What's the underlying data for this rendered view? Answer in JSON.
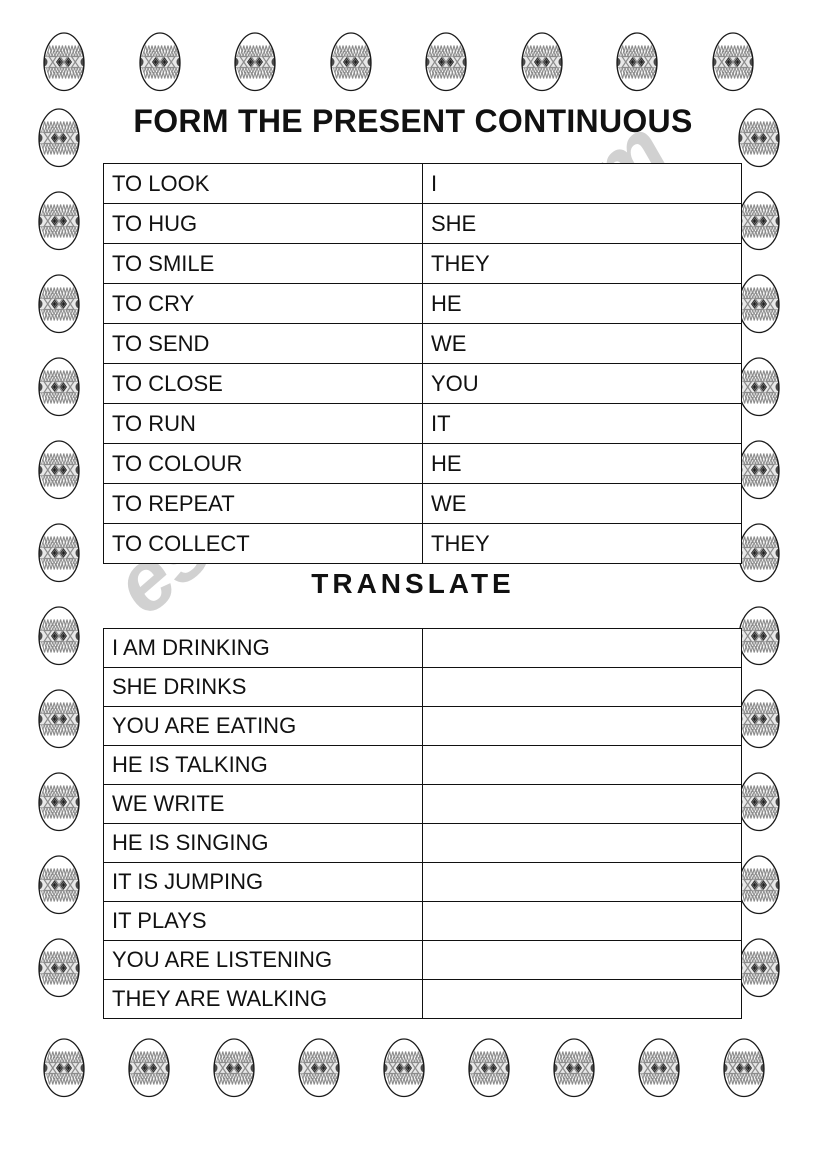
{
  "worksheet": {
    "section_one": {
      "title": "FORM THE PRESENT CONTINUOUS",
      "rows": [
        {
          "verb": "TO LOOK",
          "pronoun": "I"
        },
        {
          "verb": "TO HUG",
          "pronoun": "SHE"
        },
        {
          "verb": "TO SMILE",
          "pronoun": "THEY"
        },
        {
          "verb": "TO CRY",
          "pronoun": "HE"
        },
        {
          "verb": "TO SEND",
          "pronoun": "WE"
        },
        {
          "verb": "TO CLOSE",
          "pronoun": "YOU"
        },
        {
          "verb": "TO RUN",
          "pronoun": "IT"
        },
        {
          "verb": "TO COLOUR",
          "pronoun": "HE"
        },
        {
          "verb": "TO REPEAT",
          "pronoun": "WE"
        },
        {
          "verb": "TO COLLECT",
          "pronoun": "THEY"
        }
      ]
    },
    "section_two": {
      "title": "TRANSLATE",
      "rows": [
        {
          "sentence": "I AM DRINKING",
          "answer": ""
        },
        {
          "sentence": "SHE DRINKS",
          "answer": ""
        },
        {
          "sentence": "YOU ARE EATING",
          "answer": ""
        },
        {
          "sentence": "HE IS TALKING",
          "answer": ""
        },
        {
          "sentence": "WE WRITE",
          "answer": ""
        },
        {
          "sentence": "HE IS SINGING",
          "answer": ""
        },
        {
          "sentence": "IT IS JUMPING",
          "answer": ""
        },
        {
          "sentence": "IT PLAYS",
          "answer": ""
        },
        {
          "sentence": "YOU ARE LISTENING",
          "answer": ""
        },
        {
          "sentence": "THEY ARE WALKING",
          "answer": ""
        }
      ]
    },
    "watermark": {
      "text": "eslprintables.com",
      "color": "#c9c9c9"
    },
    "decoration": {
      "icon": "easter-egg-icon",
      "outline_color": "#1a1a1a",
      "pattern_color": "#8c8c8c",
      "top_row_count": 8,
      "bottom_row_count": 9,
      "left_column_count": 11,
      "right_column_count": 11
    }
  }
}
